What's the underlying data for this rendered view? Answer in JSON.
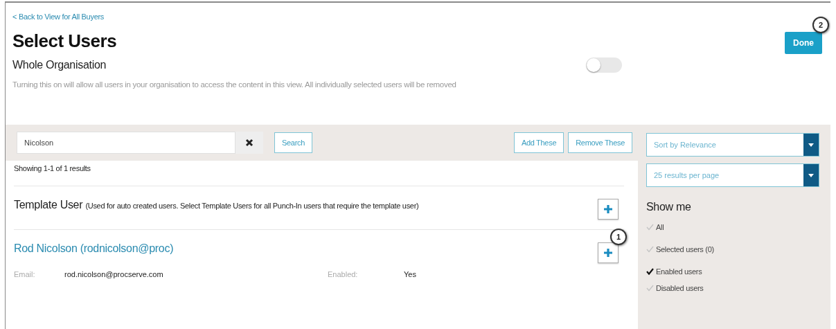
{
  "back_link": "< Back to View for All Buyers",
  "title": "Select Users",
  "done_button": {
    "label": "Done",
    "callout": "2"
  },
  "whole_organisation": {
    "label": "Whole Organisation",
    "on": false,
    "description": "Turning this on will allow all users in your organisation to access the content in this view. All individually selected users will be removed"
  },
  "search": {
    "value": "Nicolson",
    "button": "Search"
  },
  "add_button": "Add These",
  "remove_button": "Remove These",
  "result_count": "Showing 1-1 of 1 results",
  "results": [
    {
      "kind": "template",
      "name": "Template User",
      "note": "(Used for auto created users. Select Template Users for all Punch-In users that require the template user)"
    },
    {
      "kind": "user",
      "name": "Rod Nicolson (rodnicolson@proc)",
      "callout": "1",
      "fields": [
        {
          "label": "Email:",
          "value": "rod.nicolson@procserve.com"
        },
        {
          "label": "Enabled:",
          "value": "Yes"
        }
      ]
    }
  ],
  "sort_select": "Sort by Relevance",
  "page_size_select": "25 results per page",
  "filter": {
    "title": "Show me",
    "options": [
      {
        "label": "All",
        "selected": false
      },
      {
        "label": "Selected users (0)",
        "selected": false
      },
      {
        "label": "Enabled users",
        "selected": true
      },
      {
        "label": "Disabled users",
        "selected": false
      }
    ]
  }
}
